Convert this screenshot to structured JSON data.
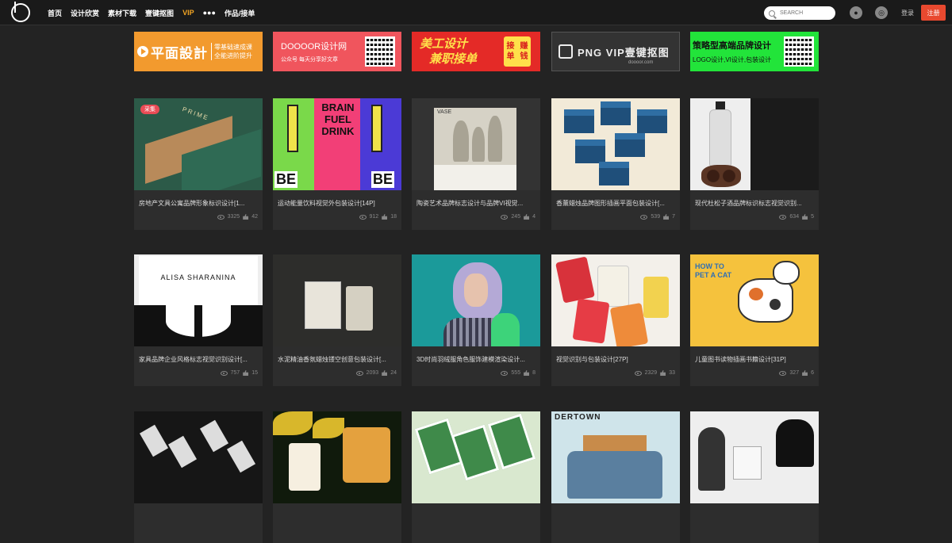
{
  "header": {
    "nav": [
      "首页",
      "设计欣赏",
      "素材下载",
      "壹键抠图",
      "VIP",
      "●●●",
      "作品/接单"
    ],
    "search_placeholder": "SEARCH",
    "login": "登录",
    "register": "注册"
  },
  "banners": [
    {
      "big": "平面設計",
      "small1": "零基础速成课",
      "small2": "全能进阶提升"
    },
    {
      "t1": "DOOOOR设计网",
      "t2": "公众号  每天分享好文章"
    },
    {
      "t1": "美工设计",
      "t2": "兼职接单",
      "tag1": "接单",
      "tag2": "赚钱"
    },
    {
      "t": "PNG  VIP壹键抠图",
      "sub": "doooor.com"
    },
    {
      "t1": "策略型高端品牌设计",
      "t2": "LOGO设计,VI设计,包装设计"
    }
  ],
  "cards": [
    {
      "title": "房地产文具公寓品牌形象标识设计[1...",
      "views": "3325",
      "likes": "42",
      "tag": "采集",
      "thumb_text": "PRIME"
    },
    {
      "title": "运动能量饮料视觉外包装设计[14P]",
      "views": "912",
      "likes": "18",
      "thumb_text": "BRAIN FUEL DRINK",
      "thumb_text2": "BE"
    },
    {
      "title": "陶瓷艺术品牌标志设计与品牌VI视觉...",
      "views": "245",
      "likes": "4",
      "thumb_text": "VASE"
    },
    {
      "title": "香薰蜡烛品牌图形插画平面包装设计[...",
      "views": "539",
      "likes": "7"
    },
    {
      "title": "现代杜松子酒品牌标识标志视觉识别...",
      "views": "634",
      "likes": "5"
    },
    {
      "title": "家具品牌企业风格标志视觉识别设计[...",
      "views": "757",
      "likes": "15",
      "thumb_text": "ALISA SHARANINA"
    },
    {
      "title": "水泥精油香氛蜡烛镂空创意包装设计[...",
      "views": "2093",
      "likes": "24"
    },
    {
      "title": "3D时尚羽绒服角色服饰建模渲染设计...",
      "views": "555",
      "likes": "8"
    },
    {
      "title": "视觉识别与包装设计[27P]",
      "views": "2329",
      "likes": "33"
    },
    {
      "title": "儿童图书读物插画书籍设计[31P]",
      "views": "327",
      "likes": "6",
      "thumb_text": "HOW TO PET A CAT"
    },
    {
      "title": "",
      "views": "",
      "likes": ""
    },
    {
      "title": "",
      "views": "",
      "likes": ""
    },
    {
      "title": "",
      "views": "",
      "likes": ""
    },
    {
      "title": "",
      "views": "",
      "likes": "",
      "thumb_text": "DERTOWN"
    },
    {
      "title": "",
      "views": "",
      "likes": ""
    }
  ]
}
